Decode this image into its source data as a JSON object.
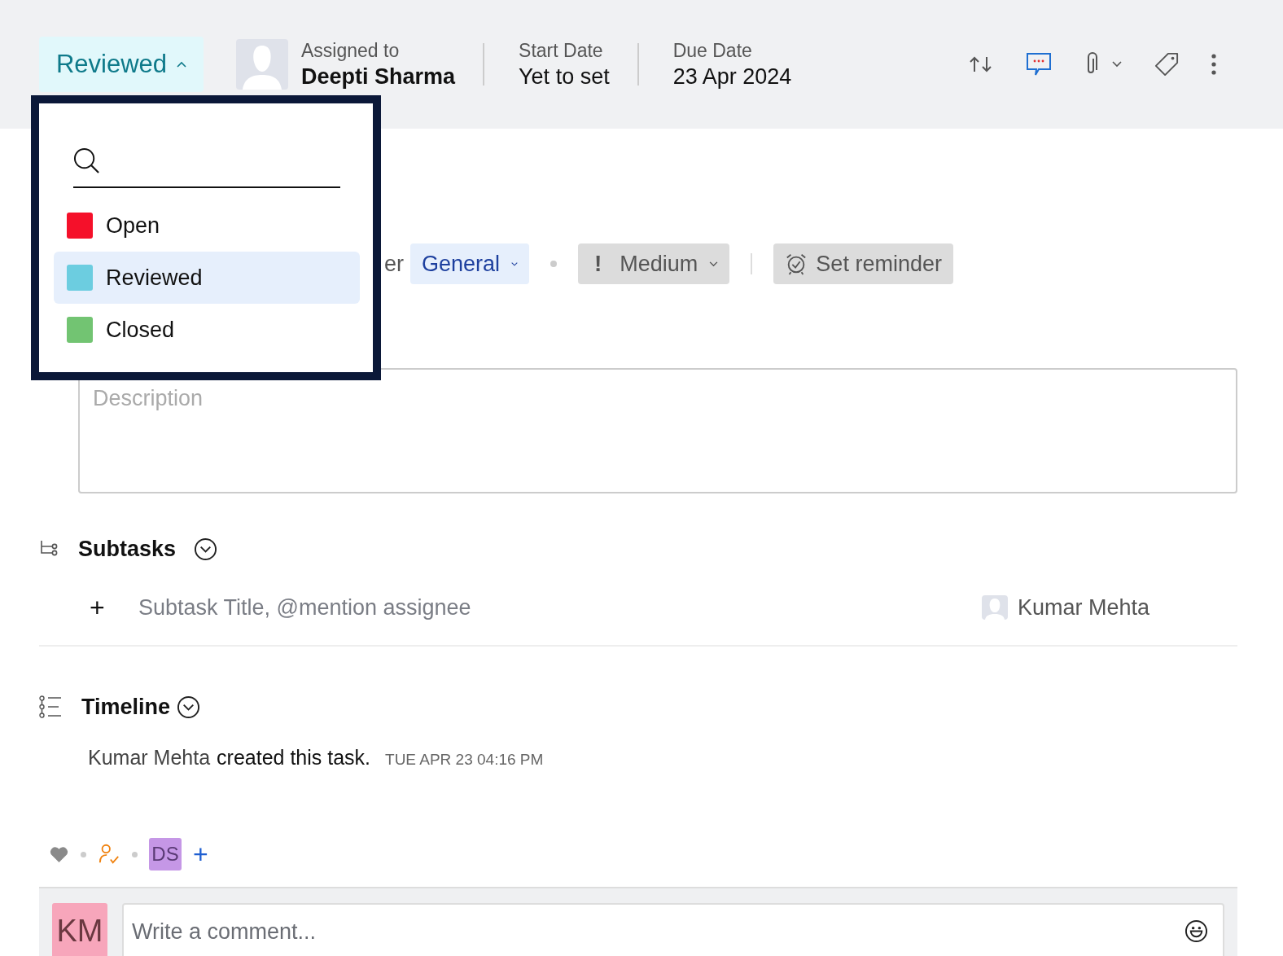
{
  "status_button": {
    "label": "Reviewed",
    "expanded": true
  },
  "assignee": {
    "label": "Assigned to",
    "name": "Deepti Sharma"
  },
  "dates": [
    {
      "label": "Start Date",
      "value": "Yet to set"
    },
    {
      "label": "Due Date",
      "value": "23 Apr 2024"
    }
  ],
  "status_menu": {
    "items": [
      {
        "label": "Open",
        "color": "#f5102a",
        "selected": false
      },
      {
        "label": "Reviewed",
        "color": "#6ccde0",
        "selected": true
      },
      {
        "label": "Closed",
        "color": "#72c472",
        "selected": false
      }
    ]
  },
  "task_meta": {
    "partial_label": "er",
    "category": "General",
    "priority_mark": "!",
    "priority": "Medium",
    "reminder": "Set reminder"
  },
  "description": {
    "placeholder": "Description"
  },
  "subtasks": {
    "title": "Subtasks",
    "add_mark": "+",
    "placeholder": "Subtask Title, @mention assignee",
    "assignee": "Kumar Mehta"
  },
  "timeline": {
    "title": "Timeline",
    "entries": [
      {
        "author": "Kumar Mehta",
        "action": "created this task.",
        "time": "TUE APR 23 04:16 PM"
      }
    ]
  },
  "followers": {
    "initials": "DS",
    "add": "+"
  },
  "comment": {
    "avatar_initials": "KM",
    "placeholder": "Write a comment..."
  }
}
